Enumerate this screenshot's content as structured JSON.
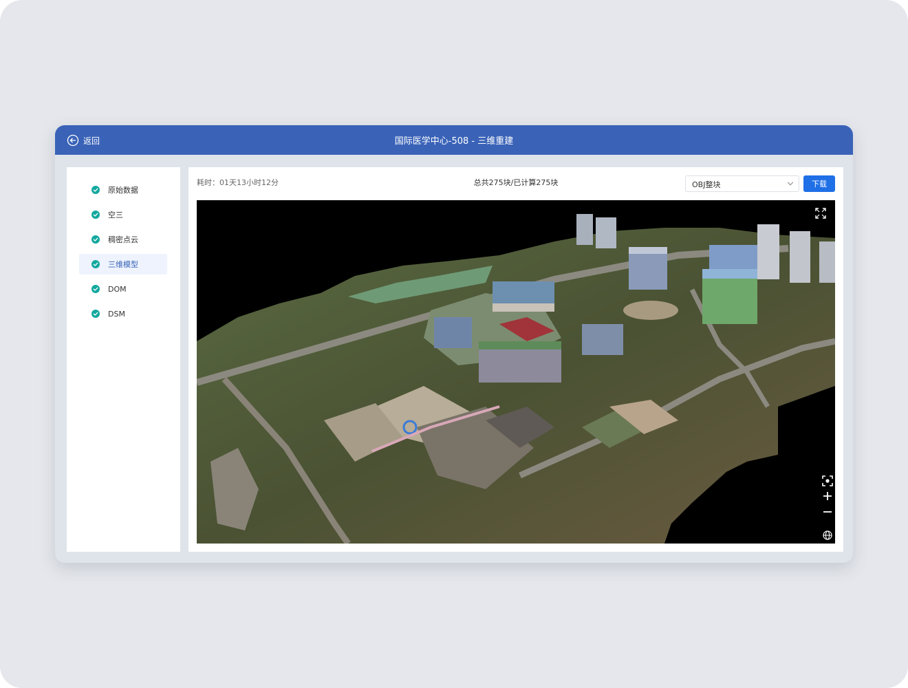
{
  "header": {
    "back_label": "返回",
    "title": "国际医学中心-508 - 三维重建"
  },
  "sidebar": {
    "steps": [
      {
        "label": "原始数据",
        "done": true
      },
      {
        "label": "空三",
        "done": true
      },
      {
        "label": "稠密点云",
        "done": true
      },
      {
        "label": "三维模型",
        "done": true,
        "active": true
      },
      {
        "label": "DOM",
        "done": true
      },
      {
        "label": "DSM",
        "done": true
      }
    ]
  },
  "toolbar": {
    "elapsed": "耗时：01天13小时12分",
    "blocks": "总共275块/已计算275块",
    "format_value": "OBJ整块",
    "download_label": "下载"
  },
  "viewer": {
    "controls": [
      "fullscreen-icon",
      "focus-icon",
      "zoom-in-icon",
      "zoom-out-icon",
      "globe-icon"
    ]
  },
  "colors": {
    "header": "#3a63b8",
    "accent": "#1f6fe6",
    "check": "#13a89e",
    "page_bg": "#e5e7ec"
  }
}
